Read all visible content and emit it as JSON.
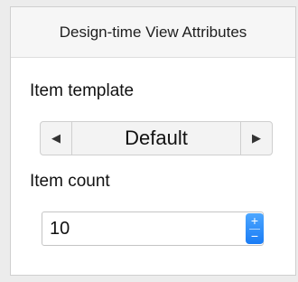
{
  "panel": {
    "title": "Design-time View Attributes"
  },
  "item_template": {
    "label": "Item template",
    "value": "Default",
    "prev_icon": "triangle-left-icon",
    "next_icon": "triangle-right-icon"
  },
  "item_count": {
    "label": "Item count",
    "value": "10",
    "increment_glyph": "+",
    "decrement_glyph": "−",
    "accent_color": "#1a7cf5"
  }
}
